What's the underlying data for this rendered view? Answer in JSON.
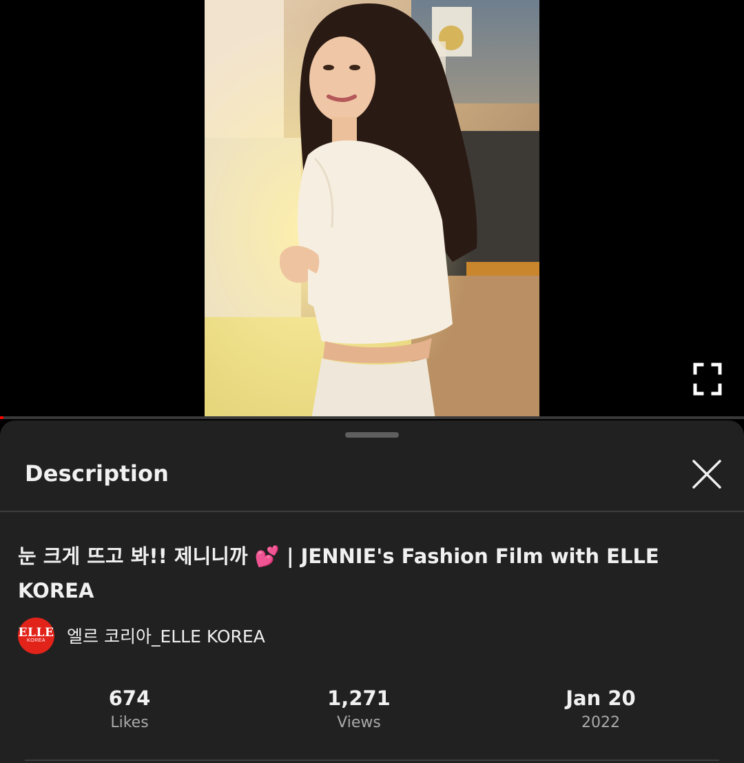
{
  "player": {
    "thumbnail_icon": "video-frame",
    "fullscreen_icon": "fullscreen-icon",
    "progress_fraction": 0.005,
    "progress_color": "#ff0000"
  },
  "description_panel": {
    "title": "Description",
    "close_icon": "close-icon",
    "video_title_text": "눈 크게 뜨고 봐!! 제니니까",
    "video_title_emoji": "💕",
    "video_title_rest": " | JENNIE's Fashion Film with ELLE KOREA",
    "channel": {
      "avatar_text": "ELLE",
      "avatar_subtext": "KOREA",
      "avatar_color": "#e2231a",
      "name": "엘르 코리아_ELLE KOREA"
    },
    "stats": [
      {
        "value": "674",
        "label": "Likes"
      },
      {
        "value": "1,271",
        "label": "Views"
      },
      {
        "value": "Jan 20",
        "label": "2022"
      }
    ]
  },
  "colors": {
    "sheet_background": "#212121",
    "secondary_text": "#aaaaaa"
  }
}
